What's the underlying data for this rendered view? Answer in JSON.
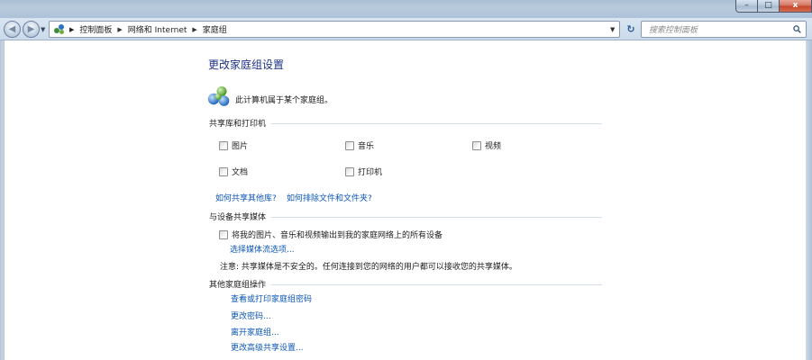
{
  "address_bar": {
    "crumbs": [
      "控制面板",
      "网络和 Internet",
      "家庭组"
    ],
    "search_placeholder": "搜索控制面板"
  },
  "caption": {
    "minimize": "–",
    "maximize": "□",
    "close": "x"
  },
  "page": {
    "title": "更改家庭组设置",
    "status": "此计算机属于某个家庭组。"
  },
  "libraries": {
    "heading": "共享库和打印机",
    "items": [
      {
        "label": "图片",
        "checked": false
      },
      {
        "label": "音乐",
        "checked": false
      },
      {
        "label": "视频",
        "checked": false
      },
      {
        "label": "文档",
        "checked": false
      },
      {
        "label": "打印机",
        "checked": false
      }
    ],
    "help_links": [
      "如何共享其他库?",
      "如何排除文件和文件夹?"
    ]
  },
  "media": {
    "heading": "与设备共享媒体",
    "stream_option": "将我的图片、音乐和视频输出到我的家庭网络上的所有设备",
    "stream_checked": false,
    "choose_link": "选择媒体流选项...",
    "note": "注意: 共享媒体是不安全的。任何连接到您的网络的用户都可以接收您的共享媒体。"
  },
  "other_actions": {
    "heading": "其他家庭组操作",
    "links": [
      "查看或打印家庭组密码",
      "更改密码...",
      "离开家庭组...",
      "更改高级共享设置..."
    ]
  },
  "colors": {
    "link": "#0d56b6",
    "title": "#1e3287"
  }
}
